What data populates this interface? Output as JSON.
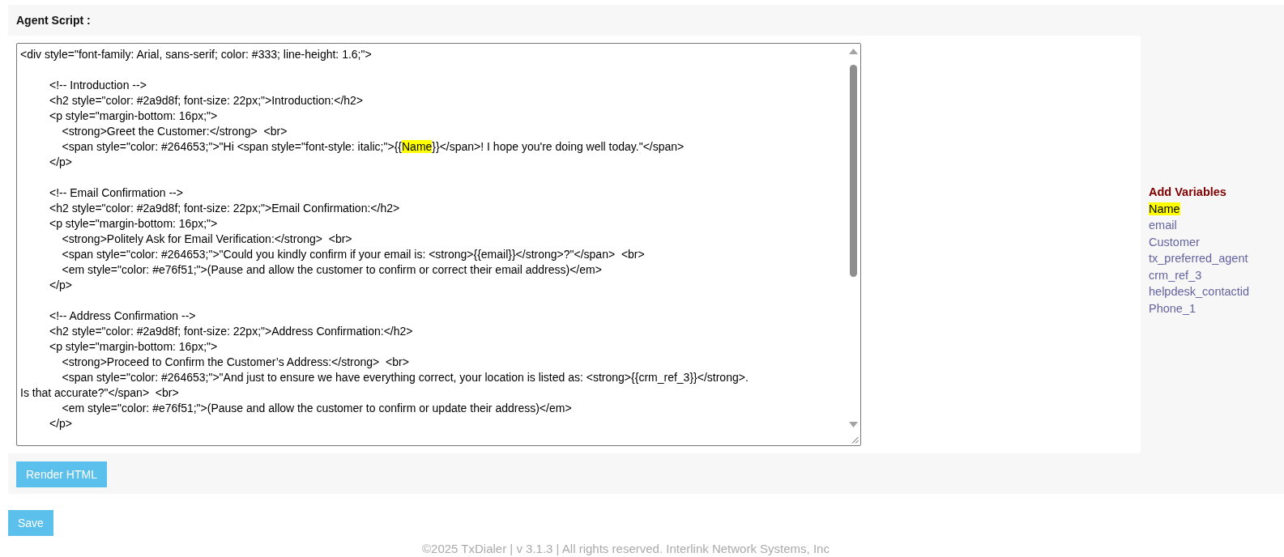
{
  "section": {
    "title": "Agent Script :"
  },
  "editor": {
    "lines": [
      {
        "kind": "code",
        "text": "<div style=\"font-family: Arial, sans-serif; color: #333; line-height: 1.6;\">"
      },
      {
        "kind": "blank"
      },
      {
        "kind": "code",
        "text": "\t<!-- Introduction -->"
      },
      {
        "kind": "code",
        "text": "\t<h2 style=\"color: #2a9d8f; font-size: 22px;\">Introduction:</h2>"
      },
      {
        "kind": "code",
        "text": "\t<p style=\"margin-bottom: 16px;\">"
      },
      {
        "kind": "code",
        "text": "\t    <strong>Greet the Customer:</strong>  <br>"
      },
      {
        "kind": "parts",
        "parts": [
          {
            "text": "\t    <span style=\"color: #264653;\">\"Hi <span style=\"font-style: italic;\">{{",
            "highlighted": false
          },
          {
            "text": "Name",
            "highlighted": true
          },
          {
            "text": "}}</span>! I hope you're doing well today.\"</span>",
            "highlighted": false
          }
        ]
      },
      {
        "kind": "code",
        "text": "\t</p>"
      },
      {
        "kind": "blank"
      },
      {
        "kind": "code",
        "text": "\t<!-- Email Confirmation -->"
      },
      {
        "kind": "code",
        "text": "\t<h2 style=\"color: #2a9d8f; font-size: 22px;\">Email Confirmation:</h2>"
      },
      {
        "kind": "code",
        "text": "\t<p style=\"margin-bottom: 16px;\">"
      },
      {
        "kind": "code",
        "text": "\t    <strong>Politely Ask for Email Verification:</strong>  <br>"
      },
      {
        "kind": "code",
        "text": "\t    <span style=\"color: #264653;\">\"Could you kindly confirm if your email is: <strong>{{email}}</strong>?\"</span>  <br>"
      },
      {
        "kind": "code",
        "text": "\t    <em style=\"color: #e76f51;\">(Pause and allow the customer to confirm or correct their email address)</em>"
      },
      {
        "kind": "code",
        "text": "\t</p>"
      },
      {
        "kind": "blank"
      },
      {
        "kind": "code",
        "text": "\t<!-- Address Confirmation -->"
      },
      {
        "kind": "code",
        "text": "\t<h2 style=\"color: #2a9d8f; font-size: 22px;\">Address Confirmation:</h2>"
      },
      {
        "kind": "code",
        "text": "\t<p style=\"margin-bottom: 16px;\">"
      },
      {
        "kind": "code",
        "text": "\t    <strong>Proceed to Confirm the Customer’s Address:</strong>  <br>"
      },
      {
        "kind": "code",
        "text": "\t    <span style=\"color: #264653;\">\"And just to ensure we have everything correct, your location is listed as: <strong>{{crm_ref_3}}</strong>."
      },
      {
        "kind": "code",
        "text": "Is that accurate?\"</span>  <br>"
      },
      {
        "kind": "code",
        "text": "\t    <em style=\"color: #e76f51;\">(Pause and allow the customer to confirm or update their address)</em>"
      },
      {
        "kind": "code",
        "text": "\t</p>"
      }
    ]
  },
  "variables": {
    "title": "Add Variables",
    "items": [
      {
        "label": "Name",
        "selected": true
      },
      {
        "label": "email",
        "selected": false
      },
      {
        "label": "Customer",
        "selected": false
      },
      {
        "label": "tx_preferred_agent",
        "selected": false
      },
      {
        "label": "crm_ref_3",
        "selected": false
      },
      {
        "label": "helpdesk_contactid",
        "selected": false
      },
      {
        "label": "Phone_1",
        "selected": false
      }
    ]
  },
  "render_button": "Render HTML",
  "save_button": "Save",
  "footer": "©2025 TxDialer | v 3.1.3 | All rights reserved. Interlink Network Systems, Inc"
}
